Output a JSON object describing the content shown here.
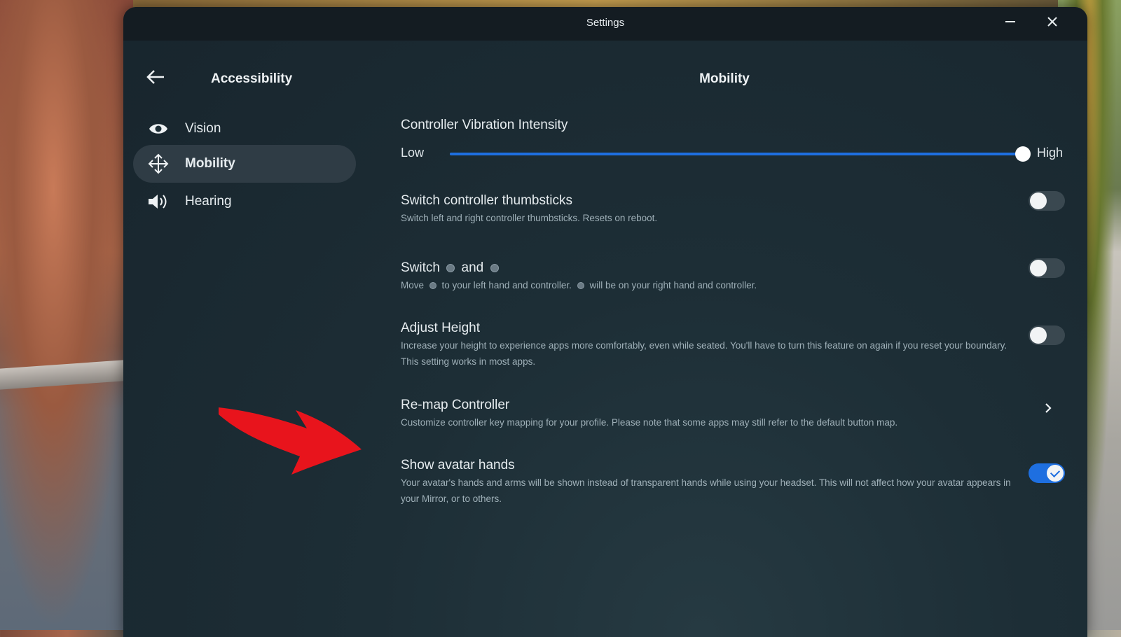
{
  "window": {
    "title": "Settings"
  },
  "sidebar": {
    "title": "Accessibility",
    "items": [
      {
        "label": "Vision",
        "icon": "eye-icon",
        "active": false
      },
      {
        "label": "Mobility",
        "icon": "move-arrows-icon",
        "active": true
      },
      {
        "label": "Hearing",
        "icon": "speaker-icon",
        "active": false
      }
    ]
  },
  "main": {
    "title": "Mobility",
    "vibration": {
      "title": "Controller Vibration Intensity",
      "low_label": "Low",
      "high_label": "High",
      "value_fraction": 1.0
    },
    "settings": [
      {
        "title": "Switch controller thumbsticks",
        "description": "Switch left and right controller thumbsticks. Resets on reboot.",
        "control": "toggle",
        "on": false
      },
      {
        "title_part1": "Switch",
        "title_part2": "and",
        "desc_part1": "Move",
        "desc_part2": "to your left hand and controller.",
        "desc_part3": "will be on your right hand and controller.",
        "control": "toggle",
        "on": false
      },
      {
        "title": "Adjust Height",
        "description": "Increase your height to experience apps more comfortably, even while seated. You'll have to turn this feature on again if you reset your boundary. This setting works in most apps.",
        "control": "toggle",
        "on": false
      },
      {
        "title": "Re-map Controller",
        "description": "Customize controller key mapping for your profile. Please note that some apps may still refer to the default button map.",
        "control": "chevron"
      },
      {
        "title": "Show avatar hands",
        "description": "Your avatar's hands and arms will be shown instead of transparent hands while using your headset. This will not affect how your avatar appears in your Mirror, or to others.",
        "control": "toggle",
        "on": true
      }
    ]
  },
  "colors": {
    "accent": "#1e6fe0",
    "annotation": "#e8141c"
  }
}
